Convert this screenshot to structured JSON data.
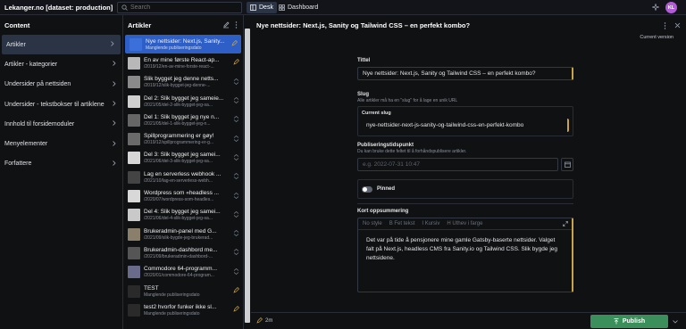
{
  "app": {
    "project_title": "Lekanger.no [dataset: production]"
  },
  "search": {
    "placeholder": "Search"
  },
  "tools": {
    "desk": "Desk",
    "dashboard": "Dashboard"
  },
  "user": {
    "initials": "KL"
  },
  "content_pane": {
    "title": "Content",
    "items": [
      {
        "label": "Artikler"
      },
      {
        "label": "Artikler - kategorier"
      },
      {
        "label": "Undersider på nettsiden"
      },
      {
        "label": "Undersider - tekstbokser til artiklene"
      },
      {
        "label": "Innhold til forsidemoduler"
      },
      {
        "label": "Menyelementer"
      },
      {
        "label": "Forfattere"
      }
    ]
  },
  "articles_pane": {
    "title": "Artikler",
    "docs": [
      {
        "title": "Nye nettsider: Next.js, Sanity...",
        "sub": "Manglende publiseringsdato",
        "thumb": "#3b6fd9",
        "status": "edit"
      },
      {
        "title": "En av mine første React-ap...",
        "sub": "/2019/12/en-av-mine-forste-react-...",
        "thumb": "#b8b8b8",
        "status": "edit"
      },
      {
        "title": "Slik bygget jeg denne netts...",
        "sub": "/2019/12/slik-bygget-jeg-denne-...",
        "thumb": "#8a8a8a",
        "status": "check"
      },
      {
        "title": "Del 2: Slik bygget jeg sameie...",
        "sub": "/2021/05/del-2-slik-bygget-jeg-sa...",
        "thumb": "#cfcfcf",
        "status": "check"
      },
      {
        "title": "Del 1: Slik bygget jeg nye n...",
        "sub": "/2021/05/del-1-slik-bygget-jeg-n...",
        "thumb": "#666666",
        "status": "check"
      },
      {
        "title": "Spillprogrammering er gøy!",
        "sub": "/2019/12/spillprogrammering-er-g...",
        "thumb": "#6a6a6a",
        "status": "check"
      },
      {
        "title": "Del 3: Slik bygget jeg samei...",
        "sub": "/2021/06/del-3-slik-bygget-jeg-sa...",
        "thumb": "#d6d6d6",
        "status": "check"
      },
      {
        "title": "Lag en serverless webhook ...",
        "sub": "/2021/10/lag-en-serverless-webh...",
        "thumb": "#444444",
        "status": "check"
      },
      {
        "title": "Wordpress som «headless ...",
        "sub": "/2020/07/wordpress-som-headles...",
        "thumb": "#d8d8d8",
        "status": "check"
      },
      {
        "title": "Del 4: Slik bygget jeg samei...",
        "sub": "/2021/06/del-4-slik-bygget-jeg-sa...",
        "thumb": "#c9c9c9",
        "status": "check"
      },
      {
        "title": "Brukeradmin-panel med G...",
        "sub": "/2021/09/slik-bygde-jeg-brukerad...",
        "thumb": "#8a7f6a",
        "status": "check"
      },
      {
        "title": "Brukeradmin-dashbord me...",
        "sub": "/2021/09/brukeradmin-dashbord-...",
        "thumb": "#555555",
        "status": "check"
      },
      {
        "title": "Commodore 64-programm...",
        "sub": "/2020/01/commodore-64-program...",
        "thumb": "#6a6a8a",
        "status": "check"
      },
      {
        "title": "TEST",
        "sub": "Manglende publiseringsdato",
        "thumb": "#2a2a2a",
        "status": "edit"
      },
      {
        "title": "test2 hvorfor funker ikke sl...",
        "sub": "Manglende publiseringsdato",
        "thumb": "#2a2a2a",
        "status": "edit"
      }
    ]
  },
  "editor": {
    "doc_title": "Nye nettsider: Next.js, Sanity og Tailwind CSS – en perfekt kombo?",
    "current_version": "Current version",
    "title_label": "Tittel",
    "title_value": "Nye nettsider: Next.js, Sanity og Tailwind CSS – en perfekt kombo?",
    "slug_label": "Slug",
    "slug_desc": "Alle artikler må ha en \"slug\" for å lage en unik URL",
    "current_slug_label": "Current slug",
    "slug_value": "nye-nettsider-next-js-sanity-og-tailwind-css-en-perfekt-kombo",
    "date_label": "Publiseringstidspunkt",
    "date_desc": "Du kan bruke dette feltet til å forhåndspublisere artikler.",
    "date_placeholder": "e.g. 2022-07-31 10:47",
    "pinned_label": "Pinned",
    "summary_label": "Kort oppsummering",
    "rt_style": "No style",
    "rt_bold": "B  Fet tekst",
    "rt_italic": "I  Kursiv",
    "rt_strike": "H  Uthev i farge",
    "summary_text": "Det var på tide å pensjonere mine gamle Gatsby-baserte nettsider. Valget falt på Next.js, headless CMS fra Sanity.io og Tailwind CSS. Slik bygde jeg nettsidene."
  },
  "footer": {
    "edited_ago": "2m",
    "publish_label": "Publish"
  }
}
